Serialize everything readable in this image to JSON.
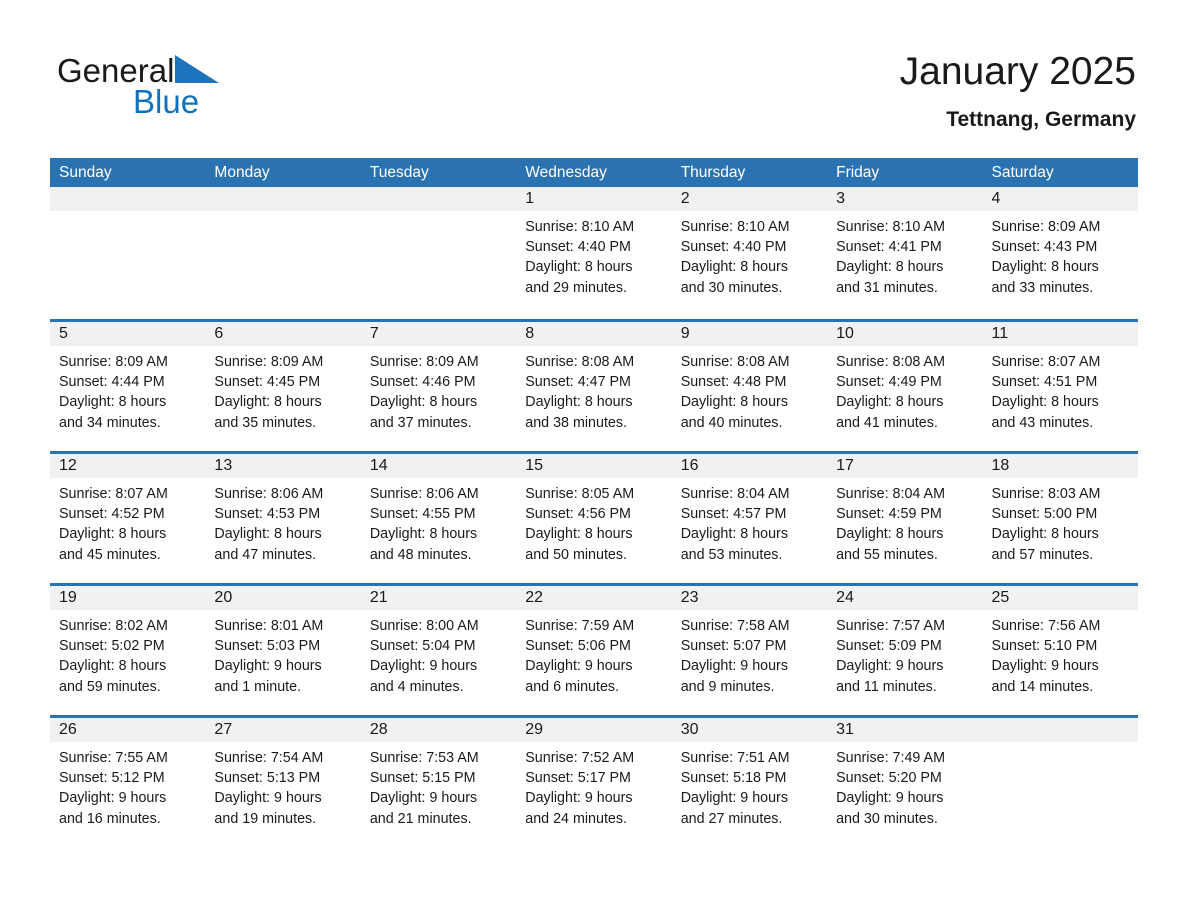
{
  "brand": {
    "name_part1": "General",
    "name_part2": "Blue",
    "triangle_icon": "triangle-icon",
    "accent_color": "#1072bd"
  },
  "header": {
    "title": "January 2025",
    "location": "Tettnang, Germany"
  },
  "theme": {
    "header_blue": "#2b72b1",
    "row_divider_blue": "#2b72b1",
    "day_band_gray": "#f1f1f1",
    "text_color": "#1a1a1a"
  },
  "calendar": {
    "weekdays": [
      "Sunday",
      "Monday",
      "Tuesday",
      "Wednesday",
      "Thursday",
      "Friday",
      "Saturday"
    ],
    "weeks": [
      [
        {
          "day": "",
          "empty": true
        },
        {
          "day": "",
          "empty": true
        },
        {
          "day": "",
          "empty": true
        },
        {
          "day": "1",
          "sunrise": "Sunrise: 8:10 AM",
          "sunset": "Sunset: 4:40 PM",
          "daylight_line1": "Daylight: 8 hours",
          "daylight_line2": "and 29 minutes."
        },
        {
          "day": "2",
          "sunrise": "Sunrise: 8:10 AM",
          "sunset": "Sunset: 4:40 PM",
          "daylight_line1": "Daylight: 8 hours",
          "daylight_line2": "and 30 minutes."
        },
        {
          "day": "3",
          "sunrise": "Sunrise: 8:10 AM",
          "sunset": "Sunset: 4:41 PM",
          "daylight_line1": "Daylight: 8 hours",
          "daylight_line2": "and 31 minutes."
        },
        {
          "day": "4",
          "sunrise": "Sunrise: 8:09 AM",
          "sunset": "Sunset: 4:43 PM",
          "daylight_line1": "Daylight: 8 hours",
          "daylight_line2": "and 33 minutes."
        }
      ],
      [
        {
          "day": "5",
          "sunrise": "Sunrise: 8:09 AM",
          "sunset": "Sunset: 4:44 PM",
          "daylight_line1": "Daylight: 8 hours",
          "daylight_line2": "and 34 minutes."
        },
        {
          "day": "6",
          "sunrise": "Sunrise: 8:09 AM",
          "sunset": "Sunset: 4:45 PM",
          "daylight_line1": "Daylight: 8 hours",
          "daylight_line2": "and 35 minutes."
        },
        {
          "day": "7",
          "sunrise": "Sunrise: 8:09 AM",
          "sunset": "Sunset: 4:46 PM",
          "daylight_line1": "Daylight: 8 hours",
          "daylight_line2": "and 37 minutes."
        },
        {
          "day": "8",
          "sunrise": "Sunrise: 8:08 AM",
          "sunset": "Sunset: 4:47 PM",
          "daylight_line1": "Daylight: 8 hours",
          "daylight_line2": "and 38 minutes."
        },
        {
          "day": "9",
          "sunrise": "Sunrise: 8:08 AM",
          "sunset": "Sunset: 4:48 PM",
          "daylight_line1": "Daylight: 8 hours",
          "daylight_line2": "and 40 minutes."
        },
        {
          "day": "10",
          "sunrise": "Sunrise: 8:08 AM",
          "sunset": "Sunset: 4:49 PM",
          "daylight_line1": "Daylight: 8 hours",
          "daylight_line2": "and 41 minutes."
        },
        {
          "day": "11",
          "sunrise": "Sunrise: 8:07 AM",
          "sunset": "Sunset: 4:51 PM",
          "daylight_line1": "Daylight: 8 hours",
          "daylight_line2": "and 43 minutes."
        }
      ],
      [
        {
          "day": "12",
          "sunrise": "Sunrise: 8:07 AM",
          "sunset": "Sunset: 4:52 PM",
          "daylight_line1": "Daylight: 8 hours",
          "daylight_line2": "and 45 minutes."
        },
        {
          "day": "13",
          "sunrise": "Sunrise: 8:06 AM",
          "sunset": "Sunset: 4:53 PM",
          "daylight_line1": "Daylight: 8 hours",
          "daylight_line2": "and 47 minutes."
        },
        {
          "day": "14",
          "sunrise": "Sunrise: 8:06 AM",
          "sunset": "Sunset: 4:55 PM",
          "daylight_line1": "Daylight: 8 hours",
          "daylight_line2": "and 48 minutes."
        },
        {
          "day": "15",
          "sunrise": "Sunrise: 8:05 AM",
          "sunset": "Sunset: 4:56 PM",
          "daylight_line1": "Daylight: 8 hours",
          "daylight_line2": "and 50 minutes."
        },
        {
          "day": "16",
          "sunrise": "Sunrise: 8:04 AM",
          "sunset": "Sunset: 4:57 PM",
          "daylight_line1": "Daylight: 8 hours",
          "daylight_line2": "and 53 minutes."
        },
        {
          "day": "17",
          "sunrise": "Sunrise: 8:04 AM",
          "sunset": "Sunset: 4:59 PM",
          "daylight_line1": "Daylight: 8 hours",
          "daylight_line2": "and 55 minutes."
        },
        {
          "day": "18",
          "sunrise": "Sunrise: 8:03 AM",
          "sunset": "Sunset: 5:00 PM",
          "daylight_line1": "Daylight: 8 hours",
          "daylight_line2": "and 57 minutes."
        }
      ],
      [
        {
          "day": "19",
          "sunrise": "Sunrise: 8:02 AM",
          "sunset": "Sunset: 5:02 PM",
          "daylight_line1": "Daylight: 8 hours",
          "daylight_line2": "and 59 minutes."
        },
        {
          "day": "20",
          "sunrise": "Sunrise: 8:01 AM",
          "sunset": "Sunset: 5:03 PM",
          "daylight_line1": "Daylight: 9 hours",
          "daylight_line2": "and 1 minute."
        },
        {
          "day": "21",
          "sunrise": "Sunrise: 8:00 AM",
          "sunset": "Sunset: 5:04 PM",
          "daylight_line1": "Daylight: 9 hours",
          "daylight_line2": "and 4 minutes."
        },
        {
          "day": "22",
          "sunrise": "Sunrise: 7:59 AM",
          "sunset": "Sunset: 5:06 PM",
          "daylight_line1": "Daylight: 9 hours",
          "daylight_line2": "and 6 minutes."
        },
        {
          "day": "23",
          "sunrise": "Sunrise: 7:58 AM",
          "sunset": "Sunset: 5:07 PM",
          "daylight_line1": "Daylight: 9 hours",
          "daylight_line2": "and 9 minutes."
        },
        {
          "day": "24",
          "sunrise": "Sunrise: 7:57 AM",
          "sunset": "Sunset: 5:09 PM",
          "daylight_line1": "Daylight: 9 hours",
          "daylight_line2": "and 11 minutes."
        },
        {
          "day": "25",
          "sunrise": "Sunrise: 7:56 AM",
          "sunset": "Sunset: 5:10 PM",
          "daylight_line1": "Daylight: 9 hours",
          "daylight_line2": "and 14 minutes."
        }
      ],
      [
        {
          "day": "26",
          "sunrise": "Sunrise: 7:55 AM",
          "sunset": "Sunset: 5:12 PM",
          "daylight_line1": "Daylight: 9 hours",
          "daylight_line2": "and 16 minutes."
        },
        {
          "day": "27",
          "sunrise": "Sunrise: 7:54 AM",
          "sunset": "Sunset: 5:13 PM",
          "daylight_line1": "Daylight: 9 hours",
          "daylight_line2": "and 19 minutes."
        },
        {
          "day": "28",
          "sunrise": "Sunrise: 7:53 AM",
          "sunset": "Sunset: 5:15 PM",
          "daylight_line1": "Daylight: 9 hours",
          "daylight_line2": "and 21 minutes."
        },
        {
          "day": "29",
          "sunrise": "Sunrise: 7:52 AM",
          "sunset": "Sunset: 5:17 PM",
          "daylight_line1": "Daylight: 9 hours",
          "daylight_line2": "and 24 minutes."
        },
        {
          "day": "30",
          "sunrise": "Sunrise: 7:51 AM",
          "sunset": "Sunset: 5:18 PM",
          "daylight_line1": "Daylight: 9 hours",
          "daylight_line2": "and 27 minutes."
        },
        {
          "day": "31",
          "sunrise": "Sunrise: 7:49 AM",
          "sunset": "Sunset: 5:20 PM",
          "daylight_line1": "Daylight: 9 hours",
          "daylight_line2": "and 30 minutes."
        },
        {
          "day": "",
          "empty": true
        }
      ]
    ]
  }
}
